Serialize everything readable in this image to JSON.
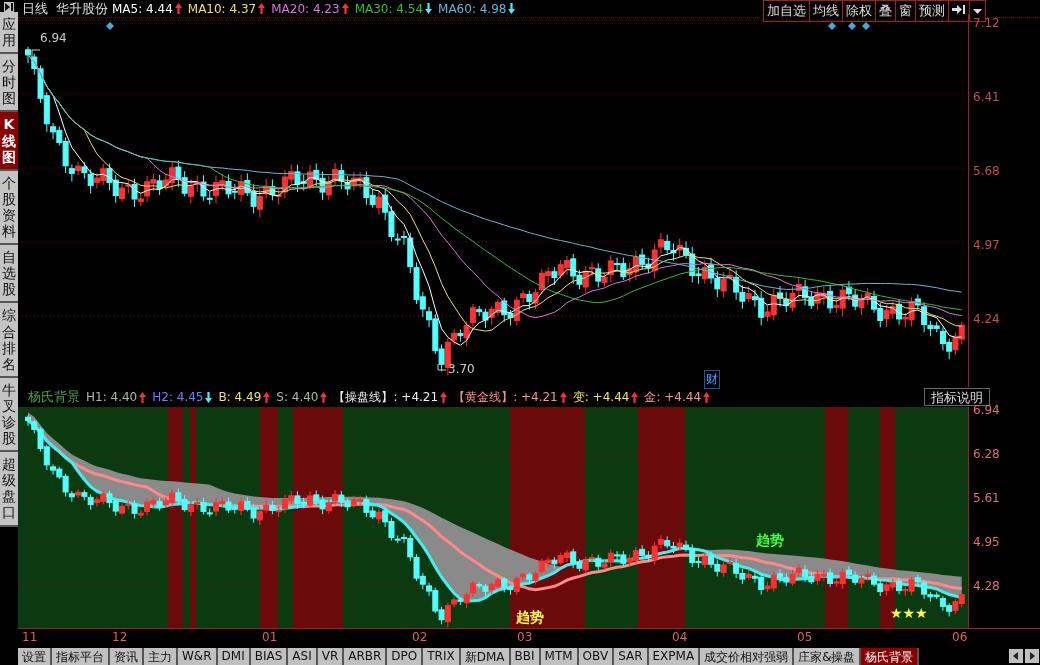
{
  "sidebar": {
    "items": [
      {
        "label": "应用",
        "selected": false
      },
      {
        "label": "分时图",
        "selected": false
      },
      {
        "label": "K线图",
        "selected": true
      },
      {
        "label": "个股资料",
        "selected": false
      },
      {
        "label": "自选股",
        "selected": false
      },
      {
        "label": "综合排名",
        "selected": false
      },
      {
        "label": "牛叉诊股",
        "selected": false
      },
      {
        "label": "超级盘口",
        "selected": false
      }
    ]
  },
  "main_chart": {
    "period": "日线",
    "stock_name": "华升股份",
    "indicators": [
      {
        "label": "MA5: 4.44",
        "kind": "up",
        "color": "#ffffff"
      },
      {
        "label": "MA10: 4.37",
        "kind": "up",
        "color": "#f0e060"
      },
      {
        "label": "MA20: 4.23",
        "kind": "up",
        "color": "#e070e0"
      },
      {
        "label": "MA30: 4.54",
        "kind": "down",
        "color": "#30c030"
      },
      {
        "label": "MA60: 4.98",
        "kind": "down",
        "color": "#60b8d8"
      }
    ],
    "toolbar": [
      "加自选",
      "均线",
      "除权",
      "叠",
      "窗",
      "预测"
    ],
    "y_axis": [
      "7.12",
      "6.41",
      "5.68",
      "4.97",
      "4.24"
    ],
    "high_label": "6.94",
    "low_label": "3.70",
    "event_marker": "财"
  },
  "indicator_chart": {
    "name": "杨氏背景",
    "values": [
      {
        "label": "H1: 4.40",
        "kind": "up",
        "color": "#a8b8a8"
      },
      {
        "label": "H2: 4.45",
        "kind": "down",
        "color": "#6a7cff"
      },
      {
        "label": "B: 4.49",
        "kind": "up",
        "color": "#f0e060"
      },
      {
        "label": "S: 4.40",
        "kind": "up",
        "color": "#a8b8a8"
      },
      {
        "label": "【操盘线】: +4.21",
        "kind": "up",
        "color": "#f0f0f0"
      },
      {
        "label": "【黄金线】: +4.21",
        "kind": "up",
        "color": "#ff9090"
      },
      {
        "label": "变: +4.44",
        "kind": "up",
        "color": "#f0e060"
      },
      {
        "label": "金: +4.44",
        "kind": "up",
        "color": "#ff9090"
      }
    ],
    "help_button": "指标说明",
    "y_axis": [
      "6.94",
      "6.28",
      "5.61",
      "4.95",
      "4.28"
    ],
    "annotations": [
      {
        "text": "趋势",
        "color": "#ffff40"
      },
      {
        "text": "趋势",
        "color": "#40ff40"
      },
      {
        "text": "★★★",
        "color": "#ffff40"
      }
    ]
  },
  "date_axis": [
    "11",
    "12",
    "01",
    "02",
    "03",
    "04",
    "05",
    "06"
  ],
  "tabs": [
    {
      "label": "设置",
      "selected": false
    },
    {
      "label": "指标平台",
      "selected": false
    },
    {
      "label": "资讯",
      "selected": false
    },
    {
      "label": "主力",
      "selected": false
    },
    {
      "label": "W&R",
      "selected": false
    },
    {
      "label": "DMI",
      "selected": false
    },
    {
      "label": "BIAS",
      "selected": false
    },
    {
      "label": "ASI",
      "selected": false
    },
    {
      "label": "VR",
      "selected": false
    },
    {
      "label": "ARBR",
      "selected": false
    },
    {
      "label": "DPO",
      "selected": false
    },
    {
      "label": "TRIX",
      "selected": false
    },
    {
      "label": "新DMA",
      "selected": false
    },
    {
      "label": "BBI",
      "selected": false
    },
    {
      "label": "MTM",
      "selected": false
    },
    {
      "label": "OBV",
      "selected": false
    },
    {
      "label": "SAR",
      "selected": false
    },
    {
      "label": "EXPMA",
      "selected": false
    },
    {
      "label": "成交价相对强弱",
      "selected": false
    },
    {
      "label": "庄家&操盘",
      "selected": false
    },
    {
      "label": "杨氏背景",
      "selected": true
    }
  ]
}
